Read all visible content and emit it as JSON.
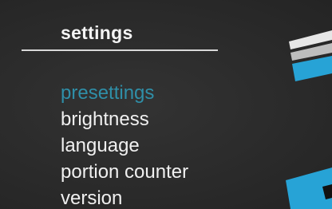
{
  "screen": {
    "title": "settings"
  },
  "menu": {
    "items": [
      {
        "label": "presettings",
        "selected": true
      },
      {
        "label": "brightness",
        "selected": false
      },
      {
        "label": "language",
        "selected": false
      },
      {
        "label": "portion counter",
        "selected": false
      },
      {
        "label": "version",
        "selected": false
      }
    ]
  },
  "colors": {
    "background": "#2c2c2c",
    "text": "#f0f0f0",
    "selected": "#2f8fa8",
    "accent_blue": "#27a3d6"
  }
}
